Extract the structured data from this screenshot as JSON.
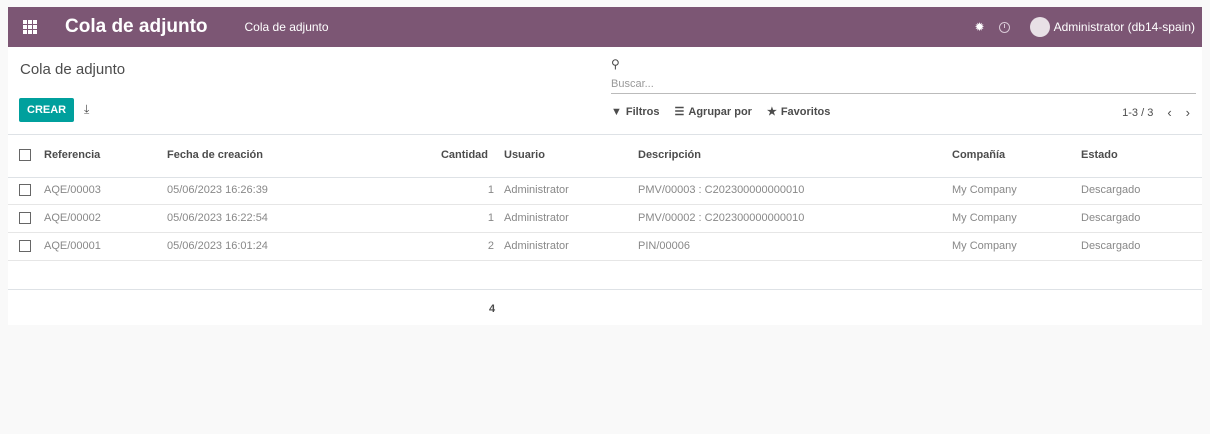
{
  "navbar": {
    "app_title": "Cola de adjunto",
    "menu_item": "Cola de adjunto",
    "user_name": "Administrator (db14-spain)",
    "icons": [
      "apps-grid-icon",
      "bug-icon",
      "clock-icon",
      "avatar"
    ]
  },
  "page": {
    "title": "Cola de adjunto",
    "create_label": "CREAR",
    "search_placeholder": "Buscar...",
    "filters_label": "Filtros",
    "group_label": "Agrupar por",
    "favorites_label": "Favoritos",
    "pager": "1-3 / 3"
  },
  "table": {
    "headers": [
      "Referencia",
      "Fecha de creación",
      "Cantidad",
      "Usuario",
      "Descripción",
      "Compañía",
      "Estado"
    ],
    "rows": [
      {
        "ref": "AQE/00003",
        "date": "05/06/2023 16:26:39",
        "qty": "1",
        "user": "Administrator",
        "desc": "PMV/00003 : C202300000000010",
        "company": "My Company",
        "state": "Descargado"
      },
      {
        "ref": "AQE/00002",
        "date": "05/06/2023 16:22:54",
        "qty": "1",
        "user": "Administrator",
        "desc": "PMV/00002 : C202300000000010",
        "company": "My Company",
        "state": "Descargado"
      },
      {
        "ref": "AQE/00001",
        "date": "05/06/2023 16:01:24",
        "qty": "2",
        "user": "Administrator",
        "desc": "PIN/00006",
        "company": "My Company",
        "state": "Descargado"
      }
    ],
    "total_qty": "4"
  },
  "colors": {
    "navbar": "#7c5674",
    "primary_button": "#00a09d"
  }
}
